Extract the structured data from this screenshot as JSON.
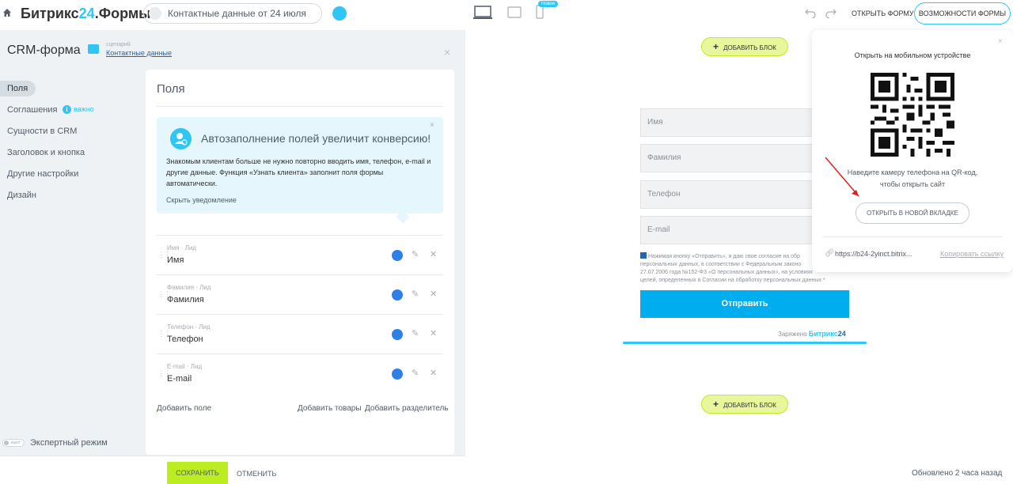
{
  "app": {
    "logo_main": "Битрикс",
    "logo_num": "24",
    "logo_suffix": ".Формы",
    "doc_title": "Контактные данные от 24 июля",
    "new_badge": "Новое",
    "open_form": "ОТКРЫТЬ ФОРМУ",
    "features": "ВОЗМОЖНОСТИ ФОРМЫ"
  },
  "panel": {
    "title": "CRM-форма",
    "scenario_caption": "сценарий",
    "scenario_link": "Контактные данные",
    "close": "×",
    "nav": [
      {
        "label": "Поля"
      },
      {
        "label": "Соглашения"
      },
      {
        "label": "Сущности в CRM"
      },
      {
        "label": "Заголовок и кнопка"
      },
      {
        "label": "Другие настройки"
      },
      {
        "label": "Дизайн"
      }
    ],
    "info_badge": "i",
    "info_text": "важно",
    "expert_toggle": "выкл",
    "expert_label": "Экспертный режим"
  },
  "card": {
    "title": "Поля",
    "notice_title": "Автозаполнение полей увеличит конверсию!",
    "notice_body": "Знакомым клиентам больше не нужно повторно вводить имя, телефон, e-mail и другие данные. Функция «Узнать клиента» заполнит поля формы автоматически.",
    "notice_hide": "Скрыть уведомление",
    "notice_close": "×",
    "fields": [
      {
        "caption": "Имя · Лид",
        "name": "Имя"
      },
      {
        "caption": "Фамилия · Лид",
        "name": "Фамилия"
      },
      {
        "caption": "Телефон · Лид",
        "name": "Телефон"
      },
      {
        "caption": "E-mail · Лид",
        "name": "E-mail"
      }
    ],
    "add_field": "Добавить поле",
    "add_products": "Добавить товары",
    "add_separator": "Добавить разделитель"
  },
  "bottom": {
    "save": "СОХРАНИТЬ",
    "cancel": "ОТМЕНИТЬ"
  },
  "preview": {
    "add_block": "ДОБАВИТЬ БЛОК",
    "inputs": [
      "Имя",
      "Фамилия",
      "Телефон",
      "E-mail"
    ],
    "consent_line1": "Нажимая кнопку «Отправить», я даю свое согласие на обр",
    "consent_line2": "персональных данных, в соответствии с Федеральным законо",
    "consent_line3": "27.07.2006 года №152-ФЗ «О персональных данных», на условиях",
    "consent_line4": "целей, определенных в Согласии на обработку персональных данных *",
    "submit": "Отправить",
    "powered_prefix": "Заряжено",
    "powered_brand": "Битрикс",
    "powered_num": "24",
    "updated": "Обновлено 2 часа назад"
  },
  "popup": {
    "title": "Открыть на мобильном устройстве",
    "hint_line1": "Наведите камеру телефона на QR-код,",
    "hint_line2": "чтобы открыть сайт",
    "open_tab": "ОТКРЫТЬ В НОВОЙ ВКЛАДКЕ",
    "url": "https://b24-2yinct.bitrix...",
    "copy": "Копировать ссылку",
    "close": "×"
  }
}
